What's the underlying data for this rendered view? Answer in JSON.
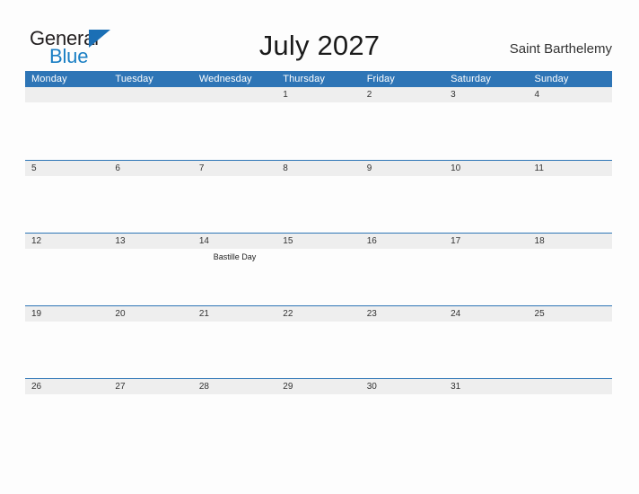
{
  "brand": {
    "word_one": "General",
    "word_two": "Blue",
    "flag_icon": "blue-triangle-flag-icon",
    "color_dark": "#231f20",
    "color_blue": "#1b7fc4"
  },
  "header": {
    "title": "July 2027",
    "location": "Saint Barthelemy"
  },
  "theme": {
    "header_blue": "#2e75b6",
    "date_band_gray": "#eeeeee",
    "page_background": "#fdfdfd",
    "text_dark": "#333333"
  },
  "calendar": {
    "weekday_headers": [
      "Monday",
      "Tuesday",
      "Wednesday",
      "Thursday",
      "Friday",
      "Saturday",
      "Sunday"
    ],
    "weeks": [
      {
        "days": [
          {
            "date": "",
            "events": []
          },
          {
            "date": "",
            "events": []
          },
          {
            "date": "",
            "events": []
          },
          {
            "date": "1",
            "events": []
          },
          {
            "date": "2",
            "events": []
          },
          {
            "date": "3",
            "events": []
          },
          {
            "date": "4",
            "events": []
          }
        ]
      },
      {
        "days": [
          {
            "date": "5",
            "events": []
          },
          {
            "date": "6",
            "events": []
          },
          {
            "date": "7",
            "events": []
          },
          {
            "date": "8",
            "events": []
          },
          {
            "date": "9",
            "events": []
          },
          {
            "date": "10",
            "events": []
          },
          {
            "date": "11",
            "events": []
          }
        ]
      },
      {
        "days": [
          {
            "date": "12",
            "events": []
          },
          {
            "date": "13",
            "events": []
          },
          {
            "date": "14",
            "events": [
              "Bastille Day"
            ]
          },
          {
            "date": "15",
            "events": []
          },
          {
            "date": "16",
            "events": []
          },
          {
            "date": "17",
            "events": []
          },
          {
            "date": "18",
            "events": []
          }
        ]
      },
      {
        "days": [
          {
            "date": "19",
            "events": []
          },
          {
            "date": "20",
            "events": []
          },
          {
            "date": "21",
            "events": []
          },
          {
            "date": "22",
            "events": []
          },
          {
            "date": "23",
            "events": []
          },
          {
            "date": "24",
            "events": []
          },
          {
            "date": "25",
            "events": []
          }
        ]
      },
      {
        "days": [
          {
            "date": "26",
            "events": []
          },
          {
            "date": "27",
            "events": []
          },
          {
            "date": "28",
            "events": []
          },
          {
            "date": "29",
            "events": []
          },
          {
            "date": "30",
            "events": []
          },
          {
            "date": "31",
            "events": []
          },
          {
            "date": "",
            "events": []
          }
        ]
      }
    ]
  }
}
